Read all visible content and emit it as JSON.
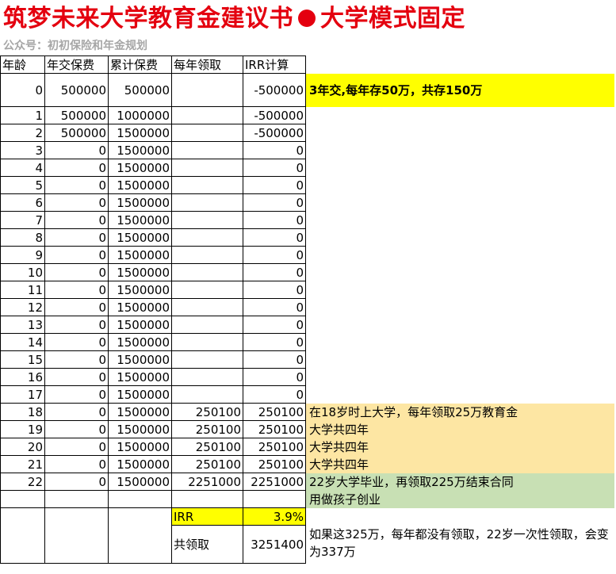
{
  "title_main": "筑梦未来大学教育金建议书",
  "title_tail": "大学模式固定",
  "subtitle": "公众号：初初保险和年金规划",
  "headers": [
    "年龄",
    "年交保费",
    "累计保费",
    "每年领取",
    "IRR计算"
  ],
  "rows": [
    {
      "age": "0",
      "premium": "500000",
      "cumulative": "500000",
      "withdraw": "",
      "irr": "-500000"
    },
    {
      "age": "1",
      "premium": "500000",
      "cumulative": "1000000",
      "withdraw": "",
      "irr": "-500000"
    },
    {
      "age": "2",
      "premium": "500000",
      "cumulative": "1500000",
      "withdraw": "",
      "irr": "-500000"
    },
    {
      "age": "3",
      "premium": "0",
      "cumulative": "1500000",
      "withdraw": "",
      "irr": "0"
    },
    {
      "age": "4",
      "premium": "0",
      "cumulative": "1500000",
      "withdraw": "",
      "irr": "0"
    },
    {
      "age": "5",
      "premium": "0",
      "cumulative": "1500000",
      "withdraw": "",
      "irr": "0"
    },
    {
      "age": "6",
      "premium": "0",
      "cumulative": "1500000",
      "withdraw": "",
      "irr": "0"
    },
    {
      "age": "7",
      "premium": "0",
      "cumulative": "1500000",
      "withdraw": "",
      "irr": "0"
    },
    {
      "age": "8",
      "premium": "0",
      "cumulative": "1500000",
      "withdraw": "",
      "irr": "0"
    },
    {
      "age": "9",
      "premium": "0",
      "cumulative": "1500000",
      "withdraw": "",
      "irr": "0"
    },
    {
      "age": "10",
      "premium": "0",
      "cumulative": "1500000",
      "withdraw": "",
      "irr": "0"
    },
    {
      "age": "11",
      "premium": "0",
      "cumulative": "1500000",
      "withdraw": "",
      "irr": "0"
    },
    {
      "age": "12",
      "premium": "0",
      "cumulative": "1500000",
      "withdraw": "",
      "irr": "0"
    },
    {
      "age": "13",
      "premium": "0",
      "cumulative": "1500000",
      "withdraw": "",
      "irr": "0"
    },
    {
      "age": "14",
      "premium": "0",
      "cumulative": "1500000",
      "withdraw": "",
      "irr": "0"
    },
    {
      "age": "15",
      "premium": "0",
      "cumulative": "1500000",
      "withdraw": "",
      "irr": "0"
    },
    {
      "age": "16",
      "premium": "0",
      "cumulative": "1500000",
      "withdraw": "",
      "irr": "0"
    },
    {
      "age": "17",
      "premium": "0",
      "cumulative": "1500000",
      "withdraw": "",
      "irr": "0"
    },
    {
      "age": "18",
      "premium": "0",
      "cumulative": "1500000",
      "withdraw": "250100",
      "irr": "250100"
    },
    {
      "age": "19",
      "premium": "0",
      "cumulative": "1500000",
      "withdraw": "250100",
      "irr": "250100"
    },
    {
      "age": "20",
      "premium": "0",
      "cumulative": "1500000",
      "withdraw": "250100",
      "irr": "250100"
    },
    {
      "age": "21",
      "premium": "0",
      "cumulative": "1500000",
      "withdraw": "250100",
      "irr": "250100"
    },
    {
      "age": "22",
      "premium": "0",
      "cumulative": "1500000",
      "withdraw": "2251000",
      "irr": "2251000"
    }
  ],
  "notes": {
    "row0": "3年交,每年存50万，共存150万",
    "row18": "在18岁时上大学，每年领取25万教育金",
    "row19": "大学共四年",
    "row20": "大学共四年",
    "row21": "大学共四年",
    "row22": "22岁大学毕业，再领取225万结束合同",
    "row23": "用做孩子创业",
    "total": "如果这325万，每年都没有领取，22岁一次性领取，会变为337万"
  },
  "summary": {
    "irr_label": "IRR",
    "irr_value": "3.9%",
    "total_label": "共领取",
    "total_value": "3251400"
  },
  "colors": {
    "title": "#e4000f",
    "subtitle": "#a6a6a6",
    "highlight_yellow": "#ffff00",
    "highlight_orange": "#fde6a3",
    "highlight_green": "#c8e0b4"
  }
}
